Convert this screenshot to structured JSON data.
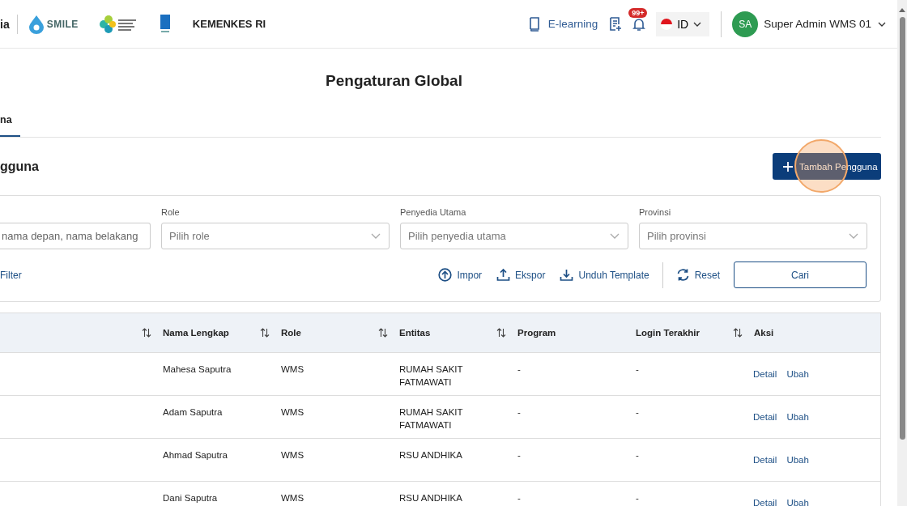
{
  "header": {
    "brand_fragment": "ia",
    "logo_text": "SMILE",
    "org_name": "KEMENKES RI",
    "elearning": "E-learning",
    "notification_badge": "99+",
    "language": "ID",
    "user": {
      "initials": "SA",
      "name": "Super Admin WMS 01"
    }
  },
  "page_title": "Pengaturan Global",
  "tabs": [
    {
      "label": "na",
      "selected": true
    }
  ],
  "section_title": "gguna",
  "add_button": "Tambah Pengguna",
  "filters": [
    {
      "kind": "text",
      "placeholder": "nama depan, nama belakang"
    },
    {
      "kind": "select",
      "label": "Role",
      "placeholder": "Pilih role"
    },
    {
      "kind": "select",
      "label": "Penyedia Utama",
      "placeholder": "Pilih penyedia utama"
    },
    {
      "kind": "select",
      "label": "Provinsi",
      "placeholder": "Pilih provinsi"
    }
  ],
  "filter_toggle": "Filter",
  "actions": [
    {
      "kind": "import",
      "label": "Impor"
    },
    {
      "kind": "export",
      "label": "Ekspor"
    },
    {
      "kind": "download",
      "label": "Unduh Template"
    },
    {
      "kind": "reset",
      "label": "Reset"
    }
  ],
  "search_button": "Cari",
  "table": {
    "columns": [
      {
        "sortable": true
      },
      {
        "label": "Nama Lengkap",
        "sortable": true
      },
      {
        "label": "Role",
        "sortable": true
      },
      {
        "label": "Entitas",
        "sortable": true
      },
      {
        "label": "Program",
        "sortable": false
      },
      {
        "label": "Login Terakhir",
        "sortable": true
      },
      {
        "label": "Aksi",
        "sortable": false
      }
    ],
    "rows": [
      {
        "cells": [
          "",
          "Mahesa Saputra",
          "WMS",
          "RUMAH SAKIT FATMAWATI",
          "-",
          "-"
        ],
        "actions": [
          "Detail",
          "Ubah"
        ]
      },
      {
        "cells": [
          "",
          "Adam Saputra",
          "WMS",
          "RUMAH SAKIT FATMAWATI",
          "-",
          "-"
        ],
        "actions": [
          "Detail",
          "Ubah"
        ]
      },
      {
        "cells": [
          "",
          "Ahmad Saputra",
          "WMS",
          "RSU ANDHIKA",
          "-",
          "-"
        ],
        "actions": [
          "Detail",
          "Ubah"
        ]
      },
      {
        "cells": [
          "",
          "Dani Saputra",
          "WMS",
          "RSU ANDHIKA",
          "-",
          "-"
        ],
        "actions": [
          "Detail",
          "Ubah"
        ]
      }
    ]
  }
}
